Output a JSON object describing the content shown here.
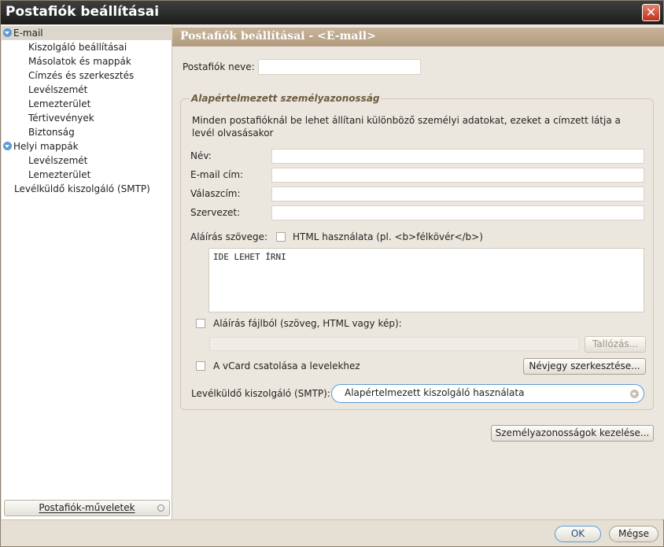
{
  "window": {
    "title": "Postafiók beállításai",
    "close_glyph": "✕"
  },
  "sidebar": {
    "items": [
      {
        "label": "E-mail"
      },
      {
        "label": "Kiszolgáló beállításai"
      },
      {
        "label": "Másolatok és mappák"
      },
      {
        "label": "Címzés és szerkesztés"
      },
      {
        "label": "Levélszemét"
      },
      {
        "label": "Lemezterület"
      },
      {
        "label": "Tértivevények"
      },
      {
        "label": "Biztonság"
      },
      {
        "label": "Helyi mappák"
      },
      {
        "label": "Levélszemét"
      },
      {
        "label": "Lemezterület"
      },
      {
        "label": "Levélküldő kiszolgáló (SMTP)"
      }
    ],
    "actions_button": "Postafiók-műveletek"
  },
  "main": {
    "header": "Postafiók beállításai - <E-mail>",
    "account_name_label": "Postafiók neve:",
    "account_name_value": "",
    "group_title": "Alapértelmezett személyazonosság",
    "group_description": "Minden postafióknál be lehet állítani különböző személyi adatokat, ezeket a címzett látja a levél olvasásakor",
    "fields": {
      "name_label": "Név:",
      "email_label": "E-mail cím:",
      "reply_label": "Válaszcím:",
      "org_label": "Szervezet:"
    },
    "signature_label": "Aláírás szövege:",
    "html_checkbox_label": "HTML használata (pl. <b>félkövér</b>)",
    "signature_text": "IDE LEHET ÍRNI",
    "signature_file_label": "Aláírás fájlból (szöveg, HTML vagy kép):",
    "browse_button": "Tallózás...",
    "vcard_label": "A vCard csatolása a levelekhez",
    "edit_card_button": "Névjegy szerkesztése...",
    "smtp_label": "Levélküldő kiszolgáló (SMTP):",
    "smtp_selected": "Alapértelmezett kiszolgáló használata",
    "manage_identities_button": "Személyazonosságok kezelése..."
  },
  "footer": {
    "ok_button": "OK",
    "cancel_button": "Mégse"
  }
}
